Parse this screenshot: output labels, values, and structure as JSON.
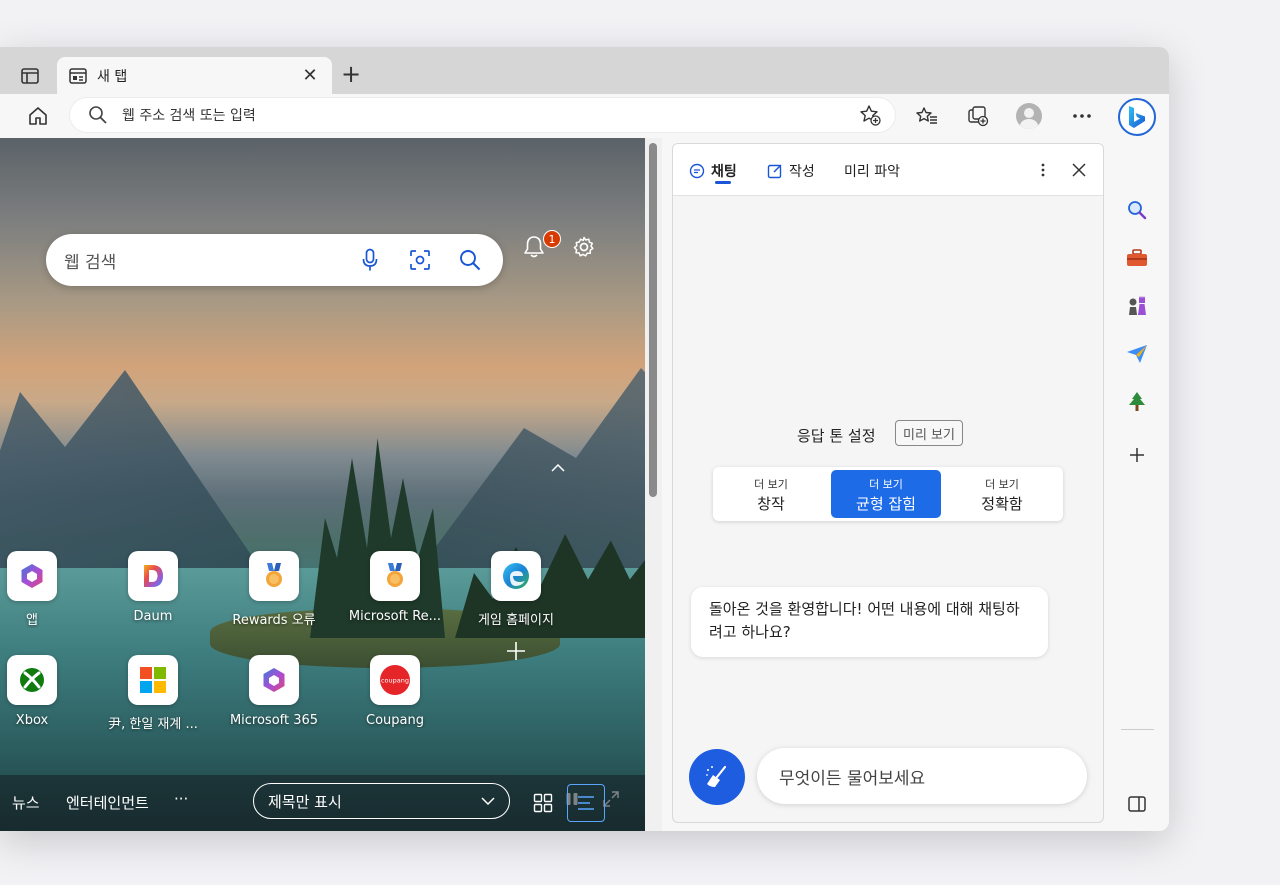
{
  "tab": {
    "title": "새 탭",
    "close_glyph": "✕"
  },
  "new_tab_glyph": "+",
  "addressbar": {
    "text": "웹 주소 검색 또는 입력"
  },
  "ntp": {
    "notification_count": "1",
    "search_placeholder": "웹 검색",
    "tiles": [
      {
        "label": "앱",
        "icon": "m365-icon"
      },
      {
        "label": "Daum",
        "icon": "daum-icon"
      },
      {
        "label": "Rewards 오류",
        "icon": "rewards-medal-icon"
      },
      {
        "label": "Microsoft Re...",
        "icon": "rewards-medal-icon"
      },
      {
        "label": "게임 홈페이지",
        "icon": "edge-icon"
      },
      {
        "label": "Xbox",
        "icon": "xbox-icon"
      },
      {
        "label": "尹, 한일 재계 ...",
        "icon": "microsoft-logo-icon"
      },
      {
        "label": "Microsoft 365",
        "icon": "m365-icon"
      },
      {
        "label": "Coupang",
        "icon": "coupang-icon"
      }
    ],
    "coupang_text": "coupang",
    "add_tile_glyph": "+",
    "feed": {
      "news": "뉴스",
      "entertainment": "엔터테인먼트",
      "more": "···",
      "select_value": "제목만 표시"
    }
  },
  "copilot": {
    "tabs": [
      {
        "label": "채팅",
        "icon": "chat-icon"
      },
      {
        "label": "작성",
        "icon": "compose-icon"
      },
      {
        "label": "미리 파악"
      }
    ],
    "tone_title": "응답 톤 설정",
    "preview_badge": "미리 보기",
    "tones": [
      {
        "small": "더 보기",
        "big": "창작"
      },
      {
        "small": "더 보기",
        "big": "균형 잡힘"
      },
      {
        "small": "더 보기",
        "big": "정확함"
      }
    ],
    "active_tone_color": "#1e6be8",
    "welcome_message": "돌아온 것을 환영합니다! 어떤 내용에 대해 채팅하려고 하나요?",
    "input_placeholder": "무엇이든 물어보세요"
  },
  "colors": {
    "accent": "#1a56d6",
    "badge": "#d83b01"
  }
}
